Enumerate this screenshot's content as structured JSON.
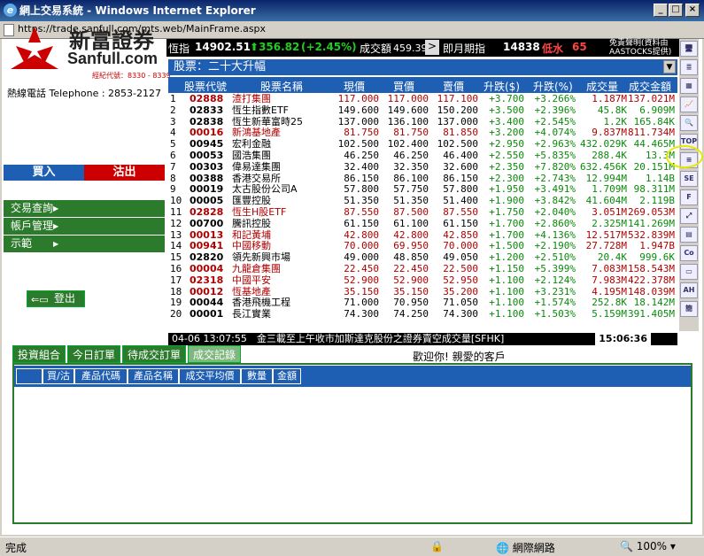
{
  "window": {
    "title": "網上交易系統 - Windows Internet Explorer",
    "url": "https://trade.sanfull.com/mts.web/MainFrame.aspx"
  },
  "brand": {
    "name_zh": "新富證券",
    "name_en": "Sanfull.com",
    "broker_code": "經紀代號：8330 - 8339",
    "hotline": "熱線電話 Telephone : 2853-2127"
  },
  "actions": {
    "buy": "買入",
    "sell": "沽出",
    "logout": "登出"
  },
  "menu": [
    "交易查詢",
    "帳戶管理",
    "示範"
  ],
  "ticker": {
    "index_label": "恆指",
    "index_value": "14902.51",
    "change": "356.82",
    "pct": "(+2.45%)",
    "turnover_label": "成交額",
    "turnover": "459.39億",
    "next_label": "即月期指",
    "futures": "14838",
    "discount_label": "低水",
    "discount": "65",
    "disclaimer": "免責聲明(資料由AASTOCKS提供)"
  },
  "grid": {
    "title": "股票：二十大升幅",
    "columns": [
      "股票代號",
      "股票名稱",
      "現價",
      "買價",
      "賣價",
      "升跌($)",
      "升跌(%)",
      "成交量",
      "成交金額"
    ],
    "rows": [
      [
        "1",
        "02888",
        "渣打集團",
        "117.000",
        "117.000",
        "117.100",
        "+3.700",
        "+3.266%",
        "1.187M",
        "137.021M",
        "red"
      ],
      [
        "2",
        "02833",
        "恆生指數ETF",
        "149.600",
        "149.600",
        "150.200",
        "+3.500",
        "+2.396%",
        "45.8K",
        "6.909M",
        "black"
      ],
      [
        "3",
        "02838",
        "恆生新華富時25",
        "137.000",
        "136.100",
        "137.000",
        "+3.400",
        "+2.545%",
        "1.2K",
        "165.84K",
        "black"
      ],
      [
        "4",
        "00016",
        "新鴻基地產",
        "81.750",
        "81.750",
        "81.850",
        "+3.200",
        "+4.074%",
        "9.837M",
        "811.734M",
        "red"
      ],
      [
        "5",
        "00945",
        "宏利金融",
        "102.500",
        "102.400",
        "102.500",
        "+2.950",
        "+2.963%",
        "432.029K",
        "44.465M",
        "black"
      ],
      [
        "6",
        "00053",
        "國浩集團",
        "46.250",
        "46.250",
        "46.400",
        "+2.550",
        "+5.835%",
        "288.4K",
        "13.3M",
        "black"
      ],
      [
        "7",
        "00303",
        "偉易達集團",
        "32.400",
        "32.350",
        "32.600",
        "+2.350",
        "+7.820%",
        "632.456K",
        "20.151M",
        "black"
      ],
      [
        "8",
        "00388",
        "香港交易所",
        "86.150",
        "86.100",
        "86.150",
        "+2.300",
        "+2.743%",
        "12.994M",
        "1.14B",
        "black"
      ],
      [
        "9",
        "00019",
        "太古股份公司A",
        "57.800",
        "57.750",
        "57.800",
        "+1.950",
        "+3.491%",
        "1.709M",
        "98.311M",
        "black"
      ],
      [
        "10",
        "00005",
        "匯豐控股",
        "51.350",
        "51.350",
        "51.400",
        "+1.900",
        "+3.842%",
        "41.604M",
        "2.119B",
        "black"
      ],
      [
        "11",
        "02828",
        "恆生H股ETF",
        "87.550",
        "87.500",
        "87.550",
        "+1.750",
        "+2.040%",
        "3.051M",
        "269.053M",
        "red"
      ],
      [
        "12",
        "00700",
        "騰訊控股",
        "61.150",
        "61.100",
        "61.150",
        "+1.700",
        "+2.860%",
        "2.325M",
        "141.269M",
        "black"
      ],
      [
        "13",
        "00013",
        "和記黃埔",
        "42.800",
        "42.800",
        "42.850",
        "+1.700",
        "+4.136%",
        "12.517M",
        "532.839M",
        "red"
      ],
      [
        "14",
        "00941",
        "中國移動",
        "70.000",
        "69.950",
        "70.000",
        "+1.500",
        "+2.190%",
        "27.728M",
        "1.947B",
        "red"
      ],
      [
        "15",
        "02820",
        "領先新興市場",
        "49.000",
        "48.850",
        "49.050",
        "+1.200",
        "+2.510%",
        "20.4K",
        "999.6K",
        "black"
      ],
      [
        "16",
        "00004",
        "九龍倉集團",
        "22.450",
        "22.450",
        "22.500",
        "+1.150",
        "+5.399%",
        "7.083M",
        "158.543M",
        "red"
      ],
      [
        "17",
        "02318",
        "中國平安",
        "52.900",
        "52.900",
        "52.950",
        "+1.100",
        "+2.124%",
        "7.983M",
        "422.378M",
        "red"
      ],
      [
        "18",
        "00012",
        "恆基地產",
        "35.150",
        "35.150",
        "35.200",
        "+1.100",
        "+3.231%",
        "4.195M",
        "148.039M",
        "red"
      ],
      [
        "19",
        "00044",
        "香港飛機工程",
        "71.000",
        "70.950",
        "71.050",
        "+1.100",
        "+1.574%",
        "252.8K",
        "18.142M",
        "black"
      ],
      [
        "20",
        "00001",
        "長江實業",
        "74.300",
        "74.250",
        "74.300",
        "+1.100",
        "+1.503%",
        "5.159M",
        "391.405M",
        "black"
      ]
    ]
  },
  "news": {
    "text": "04-06 13:07:55　金三載至上午收市加斯達克股份之證券賣空成交量[SFHK]",
    "clock": "15:06:36"
  },
  "tabs": [
    "投資組合",
    "今日訂單",
    "待成交訂單",
    "成交記錄"
  ],
  "welcome": "歡迎你! 親愛的客戶",
  "orders": {
    "columns": [
      "買/沽",
      "產品代碼",
      "產品名稱",
      "成交平均價",
      "數量",
      "金額"
    ]
  },
  "status": {
    "left": "完成",
    "zone": "網際網路",
    "zoom": "100%"
  },
  "colors": {
    "up": "#0a8a0a",
    "red": "#b00000",
    "header": "#1f5fb3",
    "menu": "#2c7a2c"
  },
  "toolbar_icons": [
    "desktop-icon",
    "list-icon",
    "grid-icon",
    "chart-icon",
    "zoom-icon",
    "top20-icon",
    "ranking-icon",
    "se-hk-icon",
    "news-icon",
    "trend-icon",
    "doc-icon",
    "co-icon",
    "folder-icon",
    "ah-icon",
    "simplified-icon"
  ]
}
